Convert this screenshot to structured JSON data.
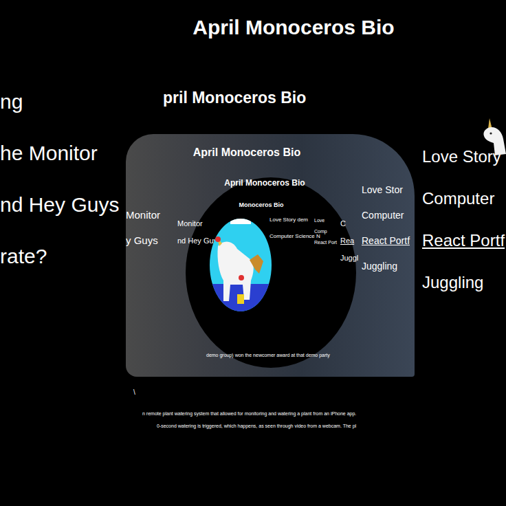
{
  "page": {
    "title": "April Monoceros Bio",
    "left_links": [
      "ng",
      "he Monitor",
      "nd Hey Guys",
      "rate?"
    ],
    "right_links": [
      {
        "label": "Love Story",
        "underlined": false
      },
      {
        "label": "Computer",
        "underlined": false
      },
      {
        "label": "React Portf",
        "underlined": true
      },
      {
        "label": "Juggling",
        "underlined": false
      }
    ],
    "captions": [
      "n remote plant watering system that allowed for monitoring and watering a plant from an iPhone app.",
      "0-second watering is triggered, which happens, as seen through video from a webcam. The pl"
    ],
    "mark": "\\"
  },
  "echo": {
    "title": "pril Monoceros Bio"
  },
  "video_frame": {
    "title": "April Monoceros Bio",
    "left_links": [
      "Monitor",
      "y Guys"
    ],
    "right_links": [
      {
        "label": "Love Stor",
        "underlined": false
      },
      {
        "label": "Computer",
        "underlined": false
      },
      {
        "label": "React Portf",
        "underlined": true
      },
      {
        "label": "Juggling",
        "underlined": false
      }
    ]
  },
  "inner_page": {
    "left_links": [
      "Monitor",
      "nd Hey Guys"
    ],
    "right_links": [
      {
        "label": "C",
        "underlined": false
      },
      {
        "label": "Rea",
        "underlined": true
      },
      {
        "label": "Juggl",
        "underlined": false
      }
    ]
  },
  "circle": {
    "title": "April Monoceros Bio",
    "subtitle": "Monoceros Bio",
    "links": [
      "Love Story dem",
      "Computer Science N"
    ],
    "deep_links": [
      "Love",
      "Comp",
      "React Port"
    ],
    "caption": "demo group) won the newcomer award at that demo party"
  }
}
